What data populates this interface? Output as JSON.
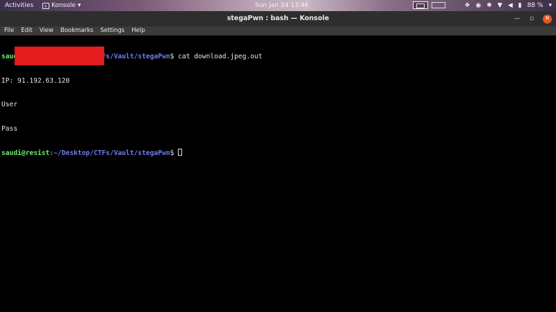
{
  "topbar": {
    "activities_label": "Activities",
    "app_name": "Konsole",
    "app_menu_arrow": "▾",
    "clock": "Sun Jan 24 13:46",
    "battery": "88 %",
    "tray_icons": [
      "screen-recorder-icon",
      "tray-indicator-icon",
      "dropbox-icon",
      "chrome-icon",
      "bluetooth-icon",
      "wifi-icon",
      "volume-icon",
      "battery-icon",
      "power-menu-icon"
    ]
  },
  "window": {
    "title": "stegaPwn : bash — Konsole",
    "minimize_glyph": "—",
    "maximize_glyph": "▫",
    "close_glyph": "✕"
  },
  "menubar": {
    "items": [
      "File",
      "Edit",
      "View",
      "Bookmarks",
      "Settings",
      "Help"
    ]
  },
  "terminal": {
    "prompt_user": "saudi@resist",
    "prompt_path": ":~/Desktop/CTFs/Vault/stegaPwn",
    "prompt_symbol": "$ ",
    "command": "cat download.jpeg.out",
    "output": [
      "IP: 91.192.63.120",
      "User",
      "Pass"
    ],
    "colors": {
      "user": "#6df06d",
      "path": "#6e7ef0",
      "redaction": "#e31d1d"
    }
  }
}
